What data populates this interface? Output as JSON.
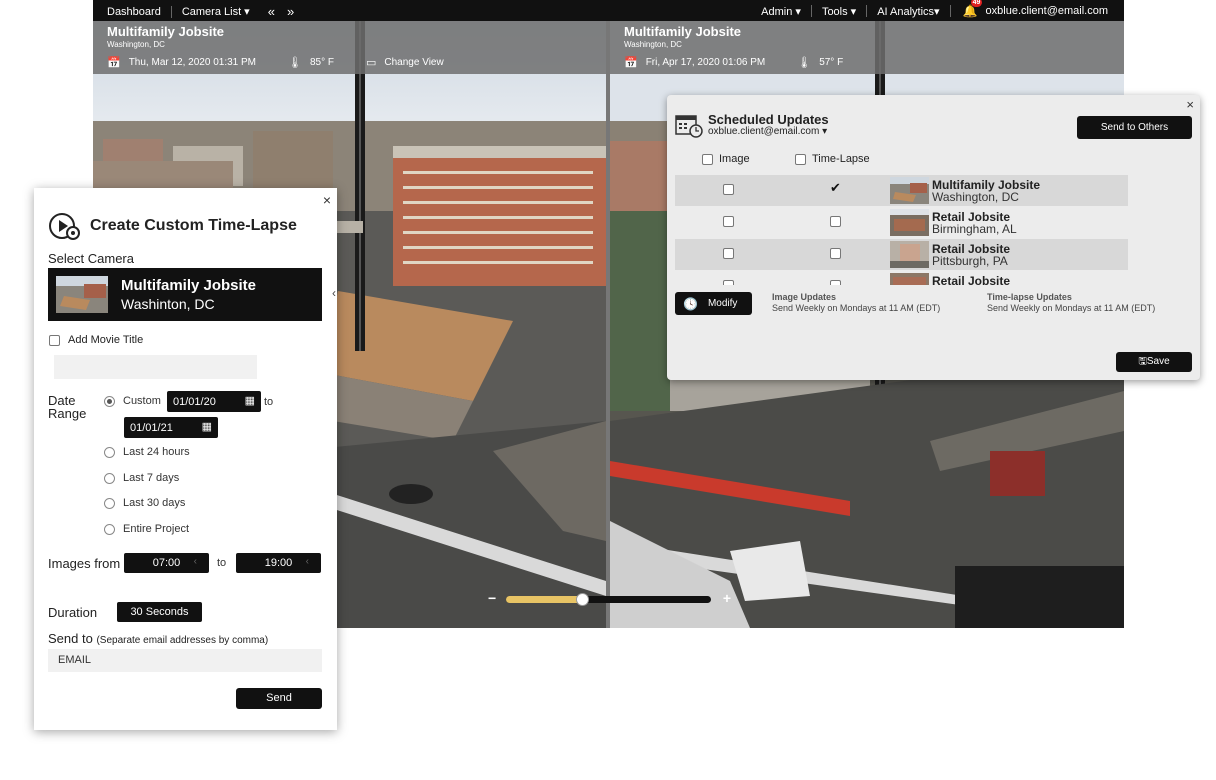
{
  "topnav": {
    "left": [
      "Dashboard",
      "Camera List ▾"
    ],
    "nav_prev": "«",
    "nav_next": "»",
    "right": [
      "Admin ▾",
      "Tools ▾",
      "AI Analytics▾"
    ],
    "notifications": "49",
    "user": "oxblue.client@email.com"
  },
  "left_camera": {
    "title": "Multifamily Jobsite",
    "location": "Washington, DC",
    "datetime": "Thu, Mar 12, 2020 01:31 PM",
    "temperature": "85° F",
    "change_view": "Change View"
  },
  "right_camera": {
    "title": "Multifamily Jobsite",
    "location": "Washington, DC",
    "datetime": "Fri, Apr 17, 2020 01:06 PM",
    "temperature": "57° F"
  },
  "zoom": {
    "minus": "−",
    "plus": "+",
    "level": 0.37
  },
  "timelapse_panel": {
    "close": "×",
    "title": "Create Custom Time-Lapse",
    "select_camera": "Select Camera",
    "camera_name": "Multifamily Jobsite",
    "camera_city": "Washinton, DC",
    "add_movie_title": "Add Movie Title",
    "date_range_label": "Date\nRange",
    "custom_label": "Custom",
    "date_from": "01/01/20",
    "to": "to",
    "date_to": "01/01/21",
    "options": [
      "Last 24 hours",
      "Last 7 days",
      "Last 30 days",
      "Entire Project"
    ],
    "images_from": "Images from",
    "time_from": "07:00",
    "time_to": "19:00",
    "duration_label": "Duration",
    "duration_value": "30 Seconds",
    "send_to": "Send to",
    "send_to_hint": "(Separate email addresses by comma)",
    "email_placeholder": "EMAIL",
    "send": "Send"
  },
  "scheduled_panel": {
    "close": "×",
    "title": "Scheduled Updates",
    "user": "oxblue.client@email.com ▾",
    "send_to_others": "Send to Others",
    "col_image": "Image",
    "col_timelapse": "Time-Lapse",
    "rows": [
      {
        "name": "Multifamily Jobsite",
        "city": "Washington, DC",
        "image": false,
        "timelapse": true
      },
      {
        "name": "Retail Jobsite",
        "city": "Birmingham, AL",
        "image": false,
        "timelapse": false
      },
      {
        "name": "Retail Jobsite",
        "city": "Pittsburgh, PA",
        "image": false,
        "timelapse": false
      },
      {
        "name": "Retail Jobsite",
        "city": "",
        "image": false,
        "timelapse": false
      }
    ],
    "modify": "Modify",
    "image_updates_title": "Image Updates",
    "image_updates_text": "Send Weekly on Mondays at 11 AM (EDT)",
    "timelapse_updates_title": "Time-lapse Updates",
    "timelapse_updates_text": "Send Weekly on Mondays at 11 AM (EDT)",
    "save": "Save"
  }
}
